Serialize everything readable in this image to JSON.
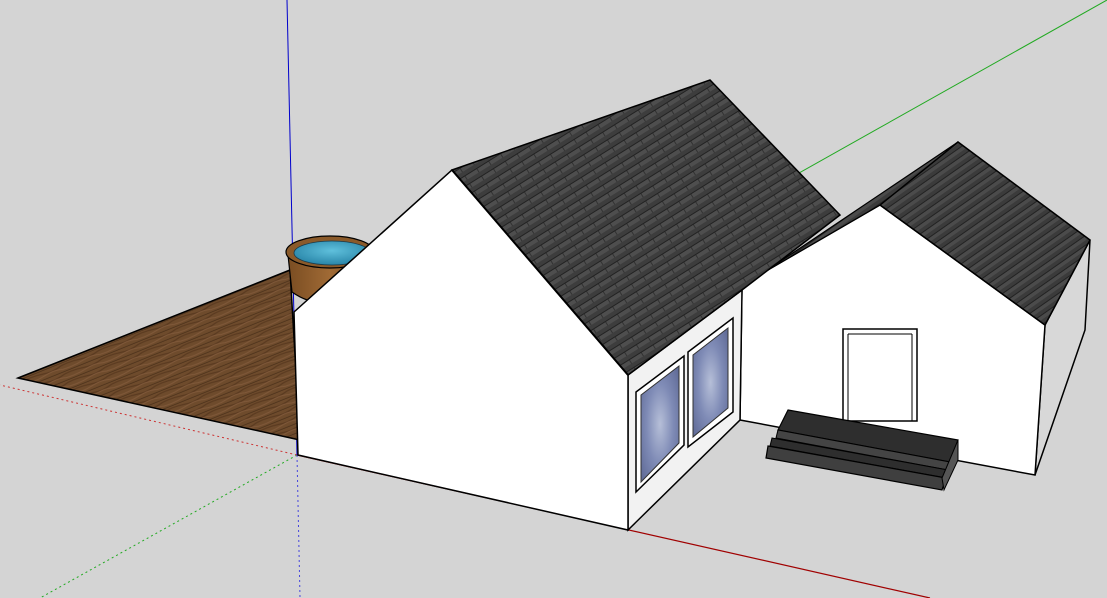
{
  "app": {
    "view": "3d-model-viewport"
  },
  "colors": {
    "background": "#d4d4d4",
    "axis_red": "#b00000",
    "axis_green": "#00a000",
    "axis_blue": "#0000c8",
    "wall_light": "#ffffff",
    "wall_shade": "#e6e6e6",
    "roof_dark": "#3a3a3a",
    "roof_mid": "#4a4a4a",
    "deck_wood": "#6b4a2c",
    "pool_water": "#2f8fb3",
    "pool_wall": "#8a5a2a",
    "glass": "#7d8ab5",
    "steps": "#3b3b3b",
    "edge": "#000000"
  },
  "model": {
    "objects": [
      "main-house",
      "garage-wing",
      "wooden-deck",
      "round-pool",
      "window-left",
      "window-right",
      "back-door",
      "entry-steps"
    ]
  }
}
